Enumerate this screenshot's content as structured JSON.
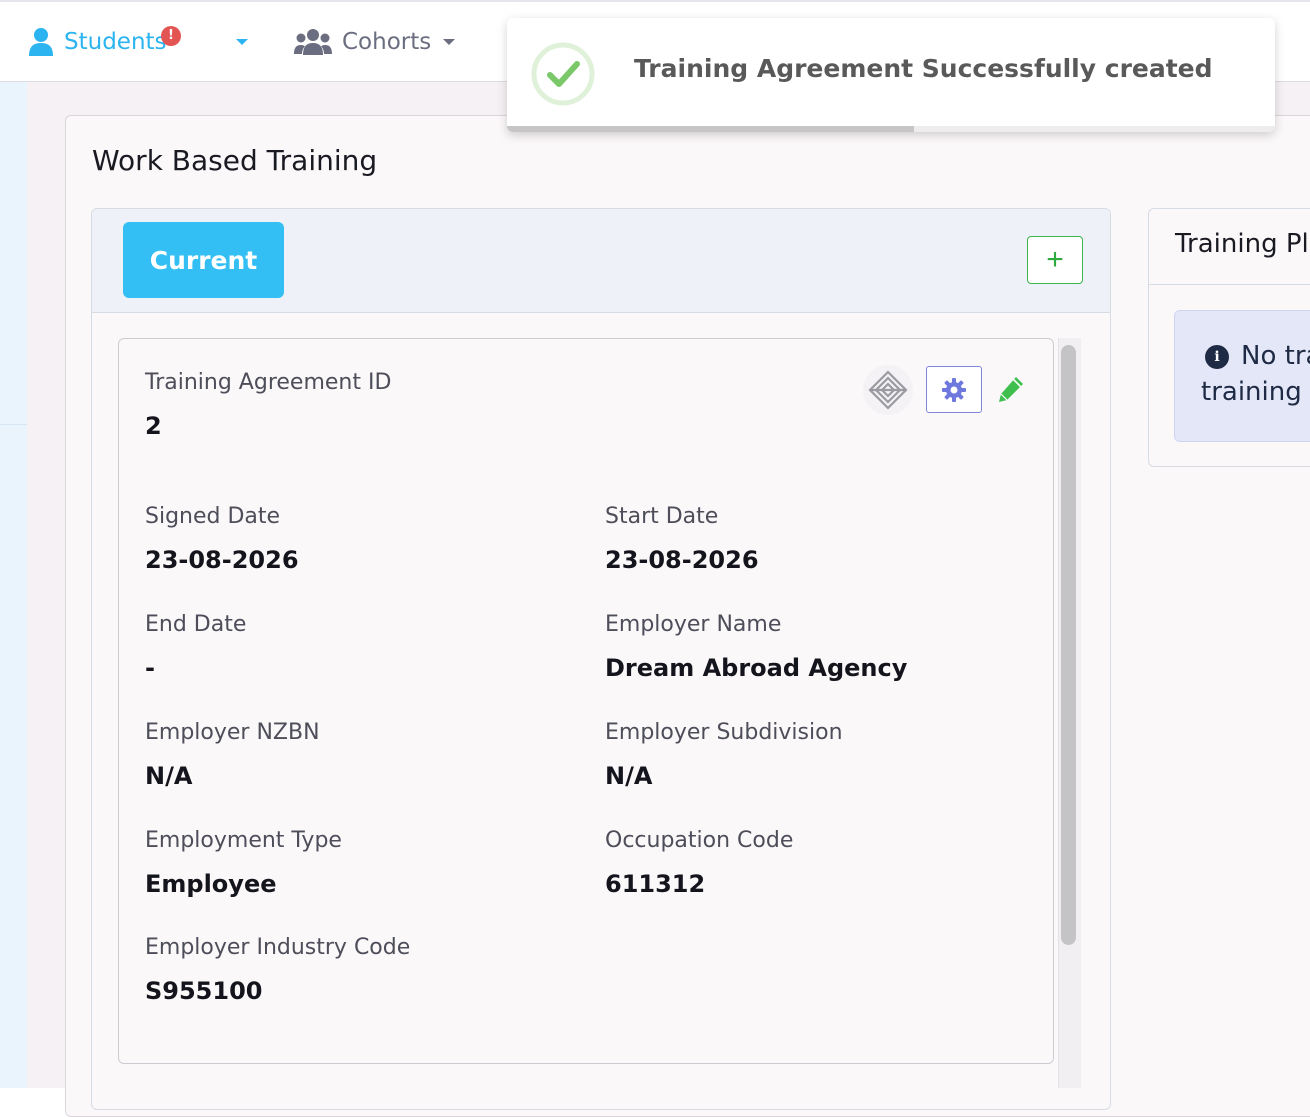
{
  "nav": {
    "students_label": "Students",
    "students_alert": "!",
    "cohorts_label": "Cohorts"
  },
  "colors": {
    "accent": "#33bff3",
    "success": "#7bc86a",
    "add_button": "#3bb54a",
    "gear": "#6e78dd",
    "alert": "#e25552"
  },
  "toast": {
    "message": "Training Agreement Successfully created",
    "icon": "check-circle-icon",
    "progress_fraction": 0.53
  },
  "panel": {
    "title": "Work Based Training"
  },
  "left_card": {
    "tab_current": "Current",
    "add_icon": "+"
  },
  "agreement": {
    "id_label": "Training Agreement ID",
    "id_value": "2",
    "fields": [
      {
        "label": "Signed Date",
        "value": "23-08-2026"
      },
      {
        "label": "Start Date",
        "value": "23-08-2026"
      },
      {
        "label": "End Date",
        "value": "-"
      },
      {
        "label": "Employer Name",
        "value": "Dream Abroad Agency"
      },
      {
        "label": "Employer NZBN",
        "value": "N/A"
      },
      {
        "label": "Employer Subdivision",
        "value": "N/A"
      },
      {
        "label": "Employment Type",
        "value": "Employee"
      },
      {
        "label": "Occupation Code",
        "value": "611312"
      },
      {
        "label": "Employer Industry Code",
        "value": "S955100"
      }
    ]
  },
  "right_card": {
    "title": "Training Pla",
    "info_line1": "No tra",
    "info_line2": "training p",
    "info_icon": "i"
  }
}
